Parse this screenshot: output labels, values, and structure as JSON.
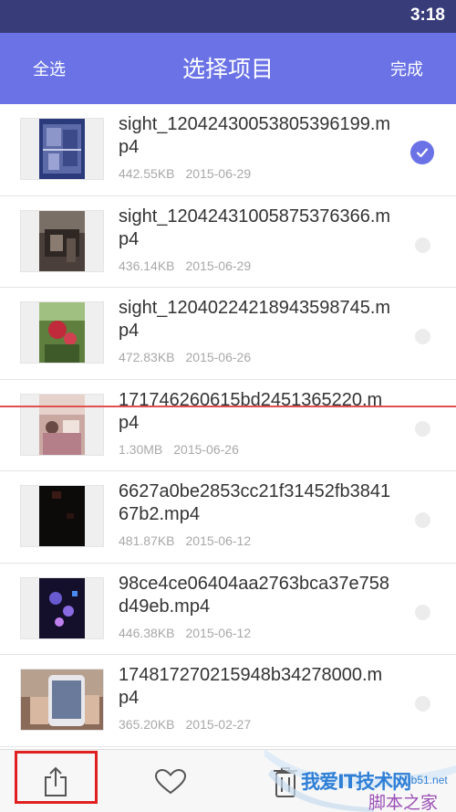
{
  "status_bar": {
    "time": "3:18"
  },
  "app_bar": {
    "select_all_label": "全选",
    "title": "选择项目",
    "done_label": "完成"
  },
  "items": [
    {
      "name": "sight_12042430053805396199.mp4",
      "size": "442.55KB",
      "date": "2015-06-29",
      "selected": true,
      "thumb": "thumb-tall-blue"
    },
    {
      "name": "sight_12042431005875376366.mp4",
      "size": "436.14KB",
      "date": "2015-06-29",
      "selected": false,
      "thumb": "thumb-tall-gray"
    },
    {
      "name": "sight_12040224218943598745.mp4",
      "size": "472.83KB",
      "date": "2015-06-26",
      "selected": false,
      "thumb": "thumb-tall-green"
    },
    {
      "name": "171746260615bd2451365220.mp4",
      "size": "1.30MB",
      "date": "2015-06-26",
      "selected": false,
      "thumb": "thumb-tall-pink"
    },
    {
      "name": "6627a0be2853cc21f31452fb384167b2.mp4",
      "size": "481.87KB",
      "date": "2015-06-12",
      "selected": false,
      "thumb": "thumb-tall-dark"
    },
    {
      "name": "98ce4ce06404aa2763bca37e758d49eb.mp4",
      "size": "446.38KB",
      "date": "2015-06-12",
      "selected": false,
      "thumb": "thumb-tall-purple"
    },
    {
      "name": "174817270215948b34278000.mp4",
      "size": "365.20KB",
      "date": "2015-02-27",
      "selected": false,
      "thumb": "thumb-wide-phone"
    }
  ],
  "bottom_bar": {
    "share_icon": "share-icon",
    "favorite_icon": "heart-icon",
    "delete_icon": "trash-icon"
  },
  "watermark": {
    "line1": "我爱IT技术网",
    "line2": "jb51.net",
    "line3": "脚本之家"
  },
  "colors": {
    "status_bar": "#383d7a",
    "app_bar": "#6a72e6",
    "accent": "#6a72e6",
    "highlight": "#e02020"
  }
}
